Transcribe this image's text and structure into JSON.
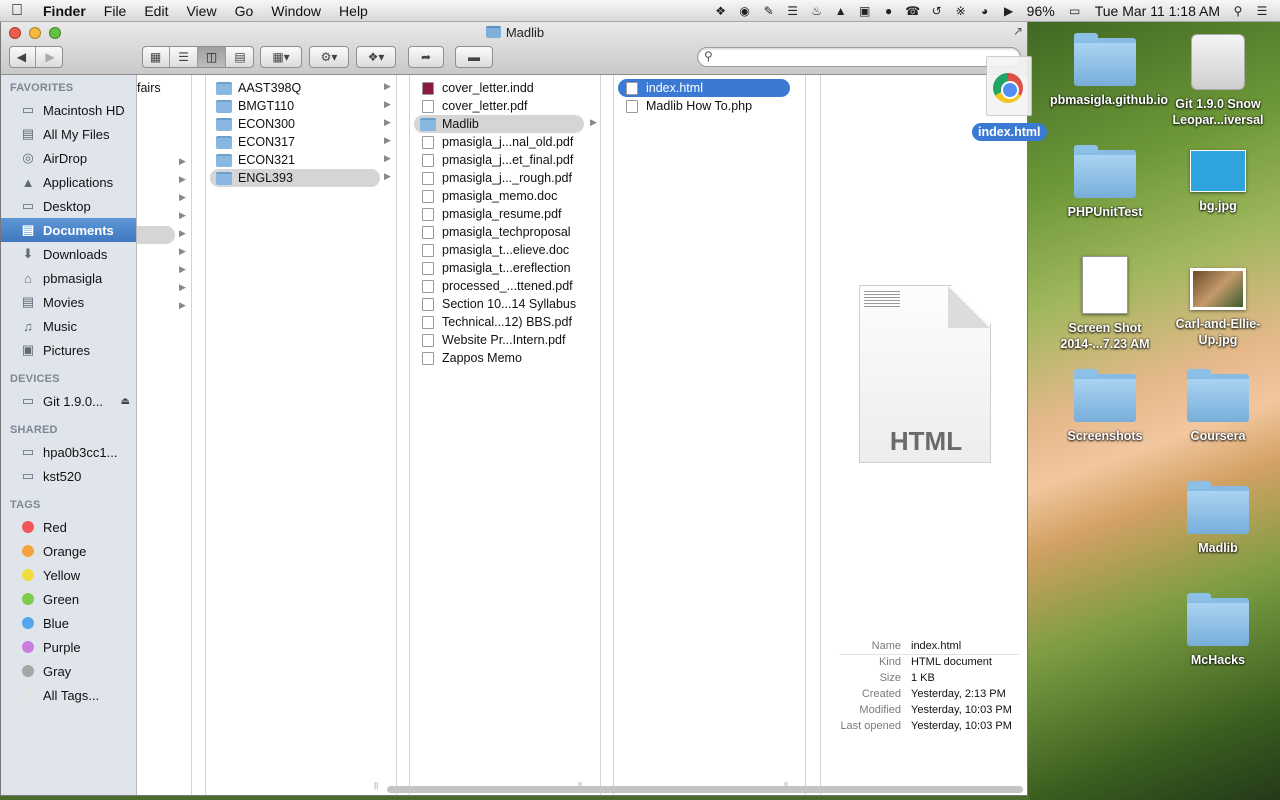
{
  "menubar": {
    "app": "Finder",
    "menus": [
      "File",
      "Edit",
      "View",
      "Go",
      "Window",
      "Help"
    ],
    "battery": "96%",
    "clock": "Tue Mar 11  1:18 AM"
  },
  "window": {
    "title": "Madlib",
    "search_placeholder": ""
  },
  "sidebar": {
    "favorites_header": "FAVORITES",
    "favorites": [
      "Macintosh HD",
      "All My Files",
      "AirDrop",
      "Applications",
      "Desktop",
      "Documents",
      "Downloads",
      "pbmasigla",
      "Movies",
      "Music",
      "Pictures"
    ],
    "favorite_icons": [
      "hard-drive-icon",
      "all-files-icon",
      "airdrop-icon",
      "applications-icon",
      "desktop-icon",
      "documents-icon",
      "downloads-icon",
      "home-icon",
      "movies-icon",
      "music-icon",
      "pictures-icon"
    ],
    "selected": "Documents",
    "devices_header": "DEVICES",
    "devices": [
      "Git 1.9.0..."
    ],
    "shared_header": "SHARED",
    "shared": [
      "hpa0b3cc1...",
      "kst520"
    ],
    "tags_header": "TAGS",
    "tags": [
      {
        "label": "Red",
        "color": "#f0575a"
      },
      {
        "label": "Orange",
        "color": "#f5a340"
      },
      {
        "label": "Yellow",
        "color": "#f2dc3b"
      },
      {
        "label": "Green",
        "color": "#7fcb4a"
      },
      {
        "label": "Blue",
        "color": "#55a5ef"
      },
      {
        "label": "Purple",
        "color": "#cb7ee0"
      },
      {
        "label": "Gray",
        "color": "#a6a6a6"
      },
      {
        "label": "All Tags...",
        "color": "#e4e4e4"
      }
    ]
  },
  "columns": {
    "col1": [
      "fairs"
    ],
    "col2": [
      "AAST398Q",
      "BMGT110",
      "ECON300",
      "ECON317",
      "ECON321",
      "ENGL393"
    ],
    "col3": [
      "cover_letter.indd",
      "cover_letter.pdf",
      "Madlib",
      "pmasigla_j...nal_old.pdf",
      "pmasigla_j...et_final.pdf",
      "pmasigla_j..._rough.pdf",
      "pmasigla_memo.doc",
      "pmasigla_resume.pdf",
      "pmasigla_techproposal",
      "pmasigla_t...elieve.doc",
      "pmasigla_t...ereflection",
      "processed_...ttened.pdf",
      "Section 10...14 Syllabus",
      "Technical...12) BBS.pdf",
      "Website Pr...Intern.pdf",
      "Zappos Memo"
    ],
    "col4": [
      "index.html",
      "Madlib How To.php"
    ]
  },
  "preview": {
    "icon_label": "HTML",
    "info": [
      {
        "k": "Name",
        "v": "index.html"
      },
      {
        "k": "Kind",
        "v": "HTML document"
      },
      {
        "k": "Size",
        "v": "1 KB"
      },
      {
        "k": "Created",
        "v": "Yesterday, 2:13 PM"
      },
      {
        "k": "Modified",
        "v": "Yesterday, 10:03 PM"
      },
      {
        "k": "Last opened",
        "v": "Yesterday, 10:03 PM"
      }
    ]
  },
  "drag": {
    "label": "index.html"
  },
  "desktop": [
    "pbmasigla.github.io",
    "Git 1.9.0 Snow Leopar...iversal",
    "PHPUnitTest",
    "bg.jpg",
    "Screen Shot 2014-...7.23 AM",
    "Carl-and-Ellie-Up.jpg",
    "Screenshots",
    "Coursera",
    "Madlib",
    "McHacks"
  ]
}
